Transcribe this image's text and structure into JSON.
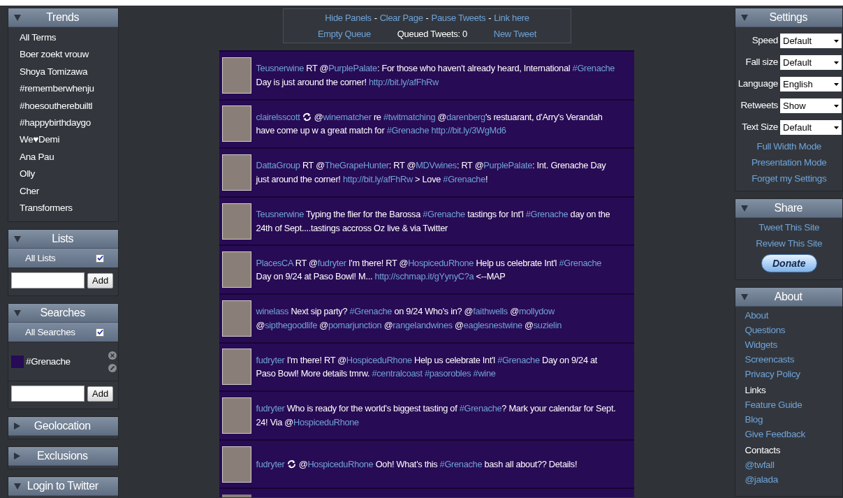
{
  "left_panels": [
    {
      "kind": "trends",
      "title": "Trends",
      "expanded": true,
      "items": [
        "All Terms",
        "Boer zoekt vrouw",
        "Shoya Tomizawa",
        "#rememberwhenju",
        "#hoesoutherebuiltl",
        "#happybirthdaygo",
        "We♥Demi",
        "Ana Pau",
        "Olly",
        "Cher",
        "Transformers"
      ]
    },
    {
      "kind": "lists",
      "title": "Lists",
      "expanded": true,
      "all_label": "All Lists",
      "all_checked": true,
      "add_label": "Add"
    },
    {
      "kind": "searches",
      "title": "Searches",
      "expanded": true,
      "all_label": "All Searches",
      "all_checked": true,
      "searches": [
        {
          "term": "#Grenache",
          "color": "#260b57"
        }
      ],
      "add_label": "Add"
    },
    {
      "kind": "plain",
      "title": "Geolocation",
      "expanded": false
    },
    {
      "kind": "plain",
      "title": "Exclusions",
      "expanded": false
    },
    {
      "kind": "plain",
      "title": "Login to Twitter",
      "expanded": true
    }
  ],
  "controls": {
    "links": [
      "Hide Panels",
      "Clear Page",
      "Pause Tweets",
      "Link here"
    ],
    "separator": "-",
    "empty_queue": "Empty Queue",
    "queued": "Queued Tweets: 0",
    "new_tweet": "New Tweet"
  },
  "tweets": [
    {
      "user": "Teusnerwine",
      "retweet": false,
      "segments": [
        {
          "t": " RT @",
          "link": false
        },
        {
          "t": "PurplePalate",
          "link": true
        },
        {
          "t": ": For those who haven't already heard, International ",
          "link": false
        },
        {
          "t": "#Grenache",
          "link": true
        },
        {
          "t": " Day is just around the corner! ",
          "link": false
        },
        {
          "t": "http://bit.ly/afFhRw",
          "link": true
        }
      ]
    },
    {
      "user": "clairelsscott",
      "retweet": true,
      "segments": [
        {
          "t": " @",
          "link": false
        },
        {
          "t": "winematcher",
          "link": true
        },
        {
          "t": " re ",
          "link": false
        },
        {
          "t": "#twitmatching",
          "link": true
        },
        {
          "t": " @",
          "link": false
        },
        {
          "t": "darenberg",
          "link": true
        },
        {
          "t": "'s restuarant, d'Arry's Verandah have come up w a great match for ",
          "link": false
        },
        {
          "t": "#Grenache",
          "link": true
        },
        {
          "t": " http://bit.ly/3WgMd6",
          "link": true
        }
      ]
    },
    {
      "user": "DattaGroup",
      "retweet": false,
      "segments": [
        {
          "t": " RT @",
          "link": false
        },
        {
          "t": "TheGrapeHunter",
          "link": true
        },
        {
          "t": ": RT @",
          "link": false
        },
        {
          "t": "MDVwines",
          "link": true
        },
        {
          "t": ": RT @",
          "link": false
        },
        {
          "t": "PurplePalate",
          "link": true
        },
        {
          "t": ": Int. Grenache Day just around the corner! ",
          "link": false
        },
        {
          "t": "http://bit.ly/afFhRw",
          "link": true
        },
        {
          "t": " > Love ",
          "link": false
        },
        {
          "t": "#Grenache",
          "link": true
        },
        {
          "t": "!",
          "link": false
        }
      ]
    },
    {
      "user": "Teusnerwine",
      "retweet": false,
      "segments": [
        {
          "t": " Typing the flier for the Barossa ",
          "link": false
        },
        {
          "t": "#Grenache",
          "link": true
        },
        {
          "t": " tastings for Int'l ",
          "link": false
        },
        {
          "t": "#Grenache",
          "link": true
        },
        {
          "t": " day on the 24th of Sept....tastings accross Oz live & via Twitter",
          "link": false
        }
      ]
    },
    {
      "user": "PlacesCA",
      "retweet": false,
      "segments": [
        {
          "t": " RT @",
          "link": false
        },
        {
          "t": "fudryter",
          "link": true
        },
        {
          "t": " I'm there! RT @",
          "link": false
        },
        {
          "t": "HospiceduRhone",
          "link": true
        },
        {
          "t": " Help us celebrate Int'l ",
          "link": false
        },
        {
          "t": "#Grenache",
          "link": true
        },
        {
          "t": " Day on 9/24 at Paso Bowl! M... ",
          "link": false
        },
        {
          "t": "http://schmap.it/gYynyC?a",
          "link": true
        },
        {
          "t": " <--MAP",
          "link": false
        }
      ]
    },
    {
      "user": "winelass",
      "retweet": false,
      "segments": [
        {
          "t": " Next sip party? ",
          "link": false
        },
        {
          "t": "#Grenache",
          "link": true
        },
        {
          "t": " on 9/24 Who's in? @",
          "link": false
        },
        {
          "t": "faithwells",
          "link": true
        },
        {
          "t": " @",
          "link": false
        },
        {
          "t": "mollydow",
          "link": true
        },
        {
          "t": " @",
          "link": false
        },
        {
          "t": "sipthegoodlife",
          "link": true
        },
        {
          "t": " @",
          "link": false
        },
        {
          "t": "pomarjunction",
          "link": true
        },
        {
          "t": " @",
          "link": false
        },
        {
          "t": "rangelandwines",
          "link": true
        },
        {
          "t": " @",
          "link": false
        },
        {
          "t": "eaglesnestwine",
          "link": true
        },
        {
          "t": " @",
          "link": false
        },
        {
          "t": "suzielin",
          "link": true
        }
      ]
    },
    {
      "user": "fudryter",
      "retweet": false,
      "segments": [
        {
          "t": " I'm there! RT @",
          "link": false
        },
        {
          "t": "HospiceduRhone",
          "link": true
        },
        {
          "t": " Help us celebrate Int'l ",
          "link": false
        },
        {
          "t": "#Grenache",
          "link": true
        },
        {
          "t": " Day on 9/24 at Paso Bowl! More details tmrw. ",
          "link": false
        },
        {
          "t": "#centralcoast",
          "link": true
        },
        {
          "t": " #pasorobles",
          "link": true
        },
        {
          "t": " #wine",
          "link": true
        }
      ]
    },
    {
      "user": "fudryter",
      "retweet": false,
      "segments": [
        {
          "t": " Who is ready for the world's biggest tasting of ",
          "link": false
        },
        {
          "t": "#Grenache",
          "link": true
        },
        {
          "t": "? Mark your calendar for Sept. 24! Via @",
          "link": false
        },
        {
          "t": "HospiceduRhone",
          "link": true
        }
      ]
    },
    {
      "user": "fudryter",
      "retweet": true,
      "segments": [
        {
          "t": " @",
          "link": false
        },
        {
          "t": "HospiceduRhone",
          "link": true
        },
        {
          "t": " Ooh! What's this ",
          "link": false
        },
        {
          "t": "#Grenache",
          "link": true
        },
        {
          "t": " bash all about?? Details!",
          "link": false
        }
      ]
    }
  ],
  "settings": {
    "title": "Settings",
    "expanded": true,
    "fields": [
      {
        "label": "Speed",
        "value": "Default"
      },
      {
        "label": "Fall size",
        "value": "Default"
      },
      {
        "label": "Language",
        "value": "English"
      },
      {
        "label": "Retweets",
        "value": "Show"
      },
      {
        "label": "Text Size",
        "value": "Default"
      }
    ],
    "links": [
      "Full Width Mode",
      "Presentation Mode",
      "Forget my Settings"
    ]
  },
  "share": {
    "title": "Share",
    "expanded": true,
    "links": [
      "Tweet This Site",
      "Review This Site"
    ],
    "donate": "Donate"
  },
  "about": {
    "title": "About",
    "expanded": true,
    "groups": [
      {
        "links": [
          "About",
          "Questions",
          "Widgets",
          "Screencasts",
          "Privacy Policy"
        ]
      },
      {
        "heading": "Links",
        "links": [
          "Feature Guide",
          "Blog",
          "Give Feedback"
        ]
      },
      {
        "heading": "Contacts",
        "links": [
          "@twfall",
          "@jalada"
        ]
      }
    ]
  }
}
